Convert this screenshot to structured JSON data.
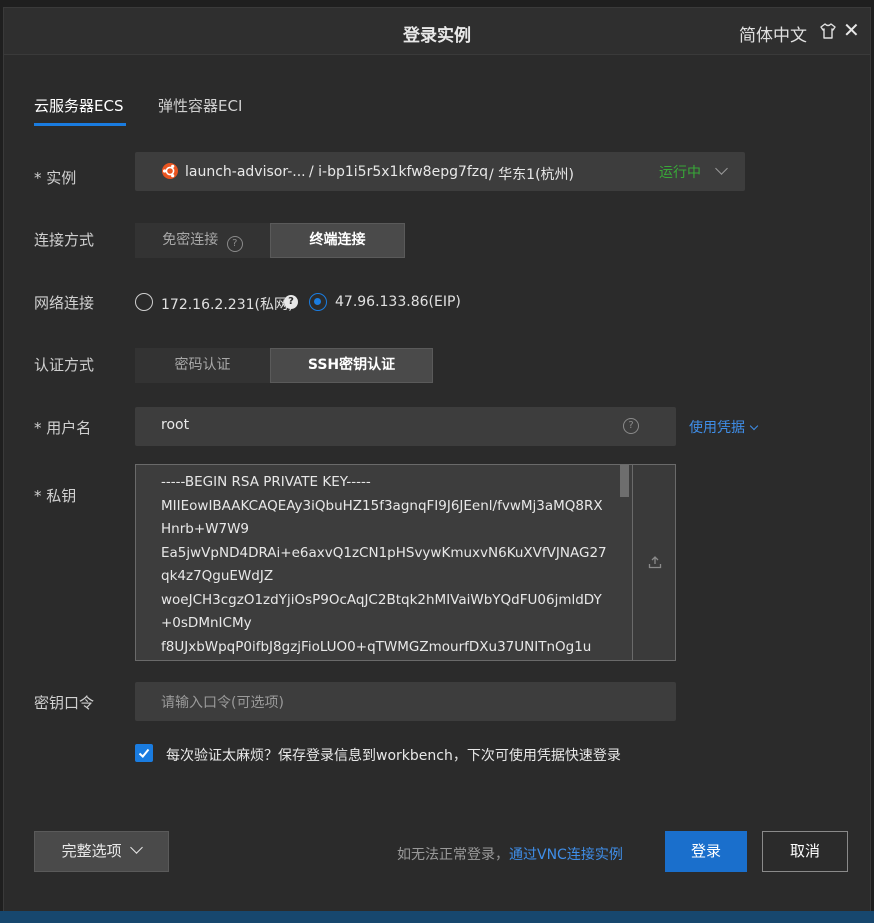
{
  "dialog": {
    "title": "登录实例",
    "language": "简体中文"
  },
  "tabs": [
    {
      "label": "云服务器ECS",
      "active": true
    },
    {
      "label": "弹性容器ECI",
      "active": false
    }
  ],
  "instance": {
    "label": "实例",
    "name": "launch-advisor-...",
    "id": "/ i-bp1i5r5x1kfw8epg7fzq",
    "region": "/ 华东1(杭州)",
    "status": "运行中",
    "status_color": "#38a838"
  },
  "connection": {
    "label": "连接方式",
    "options": [
      "免密连接",
      "终端连接"
    ],
    "selected": "终端连接"
  },
  "network": {
    "label": "网络连接",
    "options": [
      {
        "label": "172.16.2.231(私网)",
        "selected": false
      },
      {
        "label": "47.96.133.86(EIP)",
        "selected": true
      }
    ]
  },
  "auth": {
    "label": "认证方式",
    "options": [
      "密码认证",
      "SSH密钥认证"
    ],
    "selected": "SSH密钥认证"
  },
  "username": {
    "label": "用户名",
    "value": "root",
    "credential_link": "使用凭据"
  },
  "private_key": {
    "label": "私钥",
    "lines": [
      "-----BEGIN RSA PRIVATE KEY-----",
      "MIIEowIBAAKCAQEAy3iQbuHZ15f3agnqFI9J6JEenl/fvwMj3aMQ8RX",
      "Hnrb+W7W9",
      "Ea5jwVpND4DRAi+e6axvQ1zCN1pHSvywKmuxvN6KuXVfVJNAG27",
      "qk4z7QguEWdJZ",
      "woeJCH3cgzO1zdYjiOsP9OcAqJC2Btqk2hMIVaiWbYQdFU06jmldDY",
      "+0sDMnICMy",
      "f8UJxbWpqP0ifbJ8gzjFioLUO0+qTWMGZmourfDXu37UNITnOg1u"
    ]
  },
  "passphrase": {
    "label": "密钥口令",
    "placeholder": "请输入口令(可选项)"
  },
  "remember": {
    "checked": true,
    "text": "每次验证太麻烦？保存登录信息到workbench，下次可使用凭据快速登录"
  },
  "footer": {
    "options_label": "完整选项",
    "hint": "如无法正常登录，",
    "vnc_link": "通过VNC连接实例",
    "login_label": "登录",
    "cancel_label": "取消"
  },
  "colors": {
    "accent": "#1a7ce0",
    "background": "#2b2b2b",
    "link": "#3f8ee8"
  }
}
